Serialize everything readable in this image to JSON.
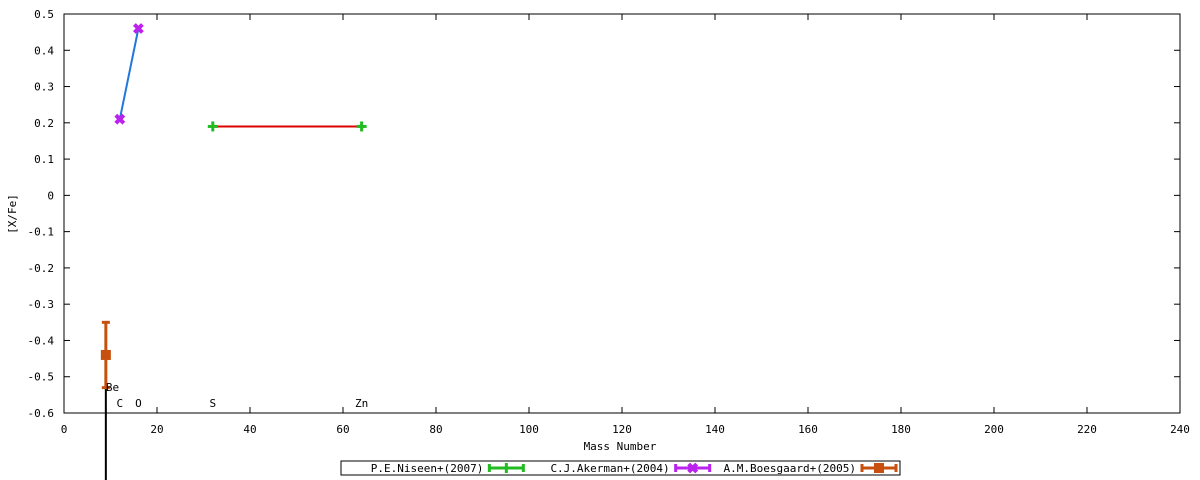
{
  "chart_data": {
    "type": "line",
    "title": "",
    "xlabel": "Mass Number",
    "ylabel": "[X/Fe]",
    "xlim": [
      0,
      240
    ],
    "ylim": [
      -0.6,
      0.5
    ],
    "xticks": [
      0,
      20,
      40,
      60,
      80,
      100,
      120,
      140,
      160,
      180,
      200,
      220,
      240
    ],
    "yticks": [
      0.5,
      0.4,
      0.3,
      0.2,
      0.1,
      0,
      -0.1,
      -0.2,
      -0.3,
      -0.4,
      -0.5,
      -0.6
    ],
    "grid": false,
    "legend_position": "bottom-center",
    "element_labels": [
      {
        "text": "Be",
        "x": 9
      },
      {
        "text": "C",
        "x": 12
      },
      {
        "text": "O",
        "x": 16
      },
      {
        "text": "S",
        "x": 32
      },
      {
        "text": "Zn",
        "x": 64
      }
    ],
    "series": [
      {
        "name": "P.E.Niseen+(2007)",
        "color": "#22bb22",
        "line_color": "#dd0000",
        "marker": "plus",
        "points": [
          {
            "x": 32,
            "y": 0.19
          },
          {
            "x": 64,
            "y": 0.19
          }
        ]
      },
      {
        "name": "C.J.Akerman+(2004)",
        "color": "#bb22ee",
        "line_color": "#2277dd",
        "marker": "cross",
        "points": [
          {
            "x": 12,
            "y": 0.21
          },
          {
            "x": 16,
            "y": 0.46
          }
        ]
      },
      {
        "name": "A.M.Boesgaard+(2005)",
        "color": "#c8500f",
        "line_color": "#c8500f",
        "marker": "square",
        "points": [
          {
            "x": 9,
            "y": -0.44,
            "err_low": 0.09,
            "err_high": 0.09
          }
        ]
      }
    ]
  }
}
